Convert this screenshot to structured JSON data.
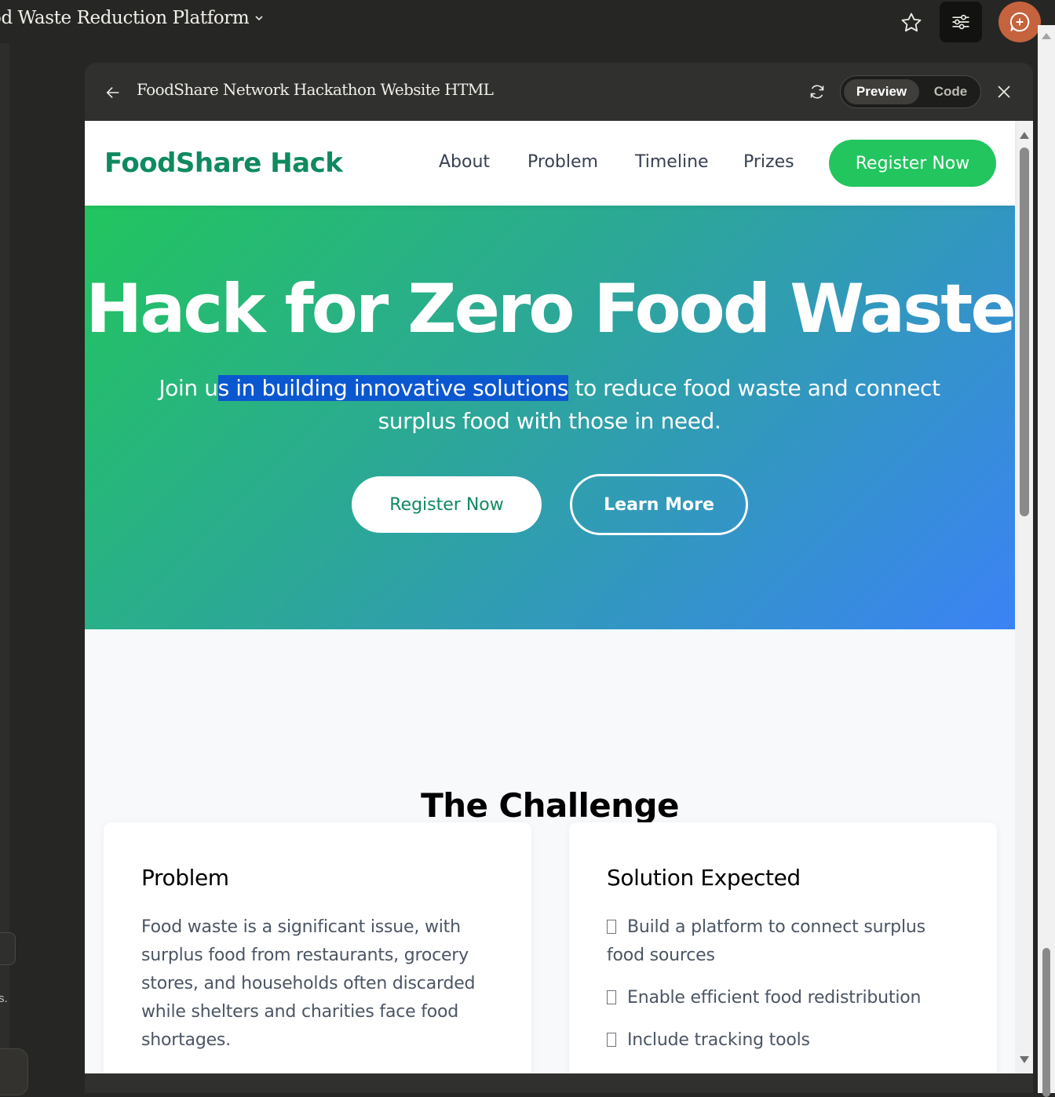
{
  "app": {
    "title": "od Waste Reduction Platform"
  },
  "artifact": {
    "title": "FoodShare Network Hackathon Website HTML",
    "toggle": {
      "preview_label": "Preview",
      "code_label": "Code",
      "selected": "Preview"
    }
  },
  "site": {
    "brand": "FoodShare Hack",
    "nav": [
      {
        "label": "About"
      },
      {
        "label": "Problem"
      },
      {
        "label": "Timeline"
      },
      {
        "label": "Prizes"
      }
    ],
    "nav_cta": "Register Now",
    "hero": {
      "title": "Hack for Zero Food Waste",
      "subtitle_before": "Join u",
      "subtitle_selected": "s in building innovative solutions",
      "subtitle_after": " to reduce food waste and connect surplus food with those in need.",
      "primary_button": "Register Now",
      "secondary_button": "Learn More"
    },
    "challenge": {
      "heading": "The Challenge",
      "problem": {
        "title": "Problem",
        "text": "Food waste is a significant issue, with surplus food from restaurants, grocery stores, and households often discarded while shelters and charities face food shortages."
      },
      "solution": {
        "title": "Solution Expected",
        "items": [
          "Build a platform to connect surplus food sources",
          "Enable efficient food redistribution",
          "Include tracking tools"
        ]
      }
    }
  },
  "sidebar": {
    "snippet": "s."
  },
  "colors": {
    "brand_green": "#0f8a5f",
    "cta_green": "#22c55e",
    "hero_gradient_start": "#22c55e",
    "hero_gradient_end": "#3b82f6",
    "selection_highlight": "#0b57d0",
    "avatar": "#c4633e"
  },
  "icons": [
    "chevron-down-icon",
    "star-icon",
    "sliders-icon",
    "chat-plus-icon",
    "arrow-left-icon",
    "refresh-icon",
    "close-icon",
    "checkbox-icon"
  ]
}
